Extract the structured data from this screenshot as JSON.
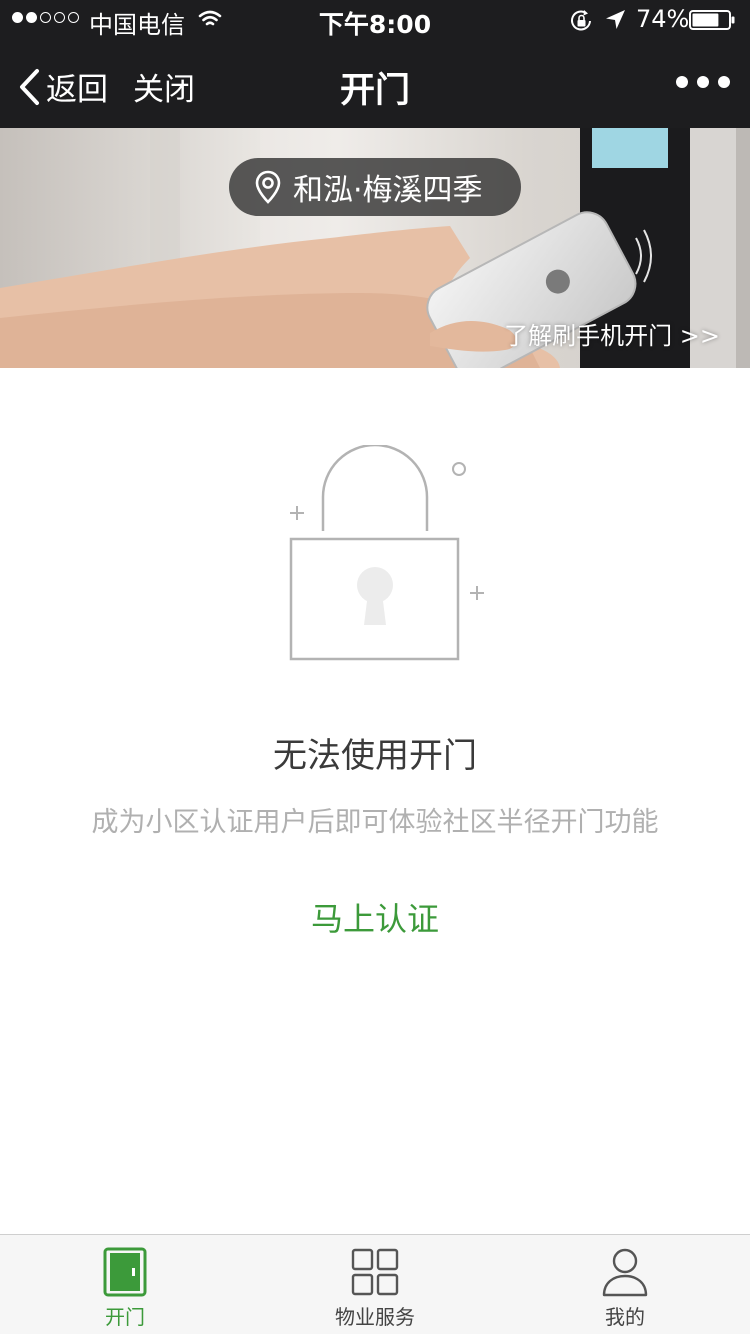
{
  "status_bar": {
    "carrier": "中国电信",
    "time": "下午8:00",
    "battery": "74%",
    "signal_strength": 2,
    "signal_max": 5,
    "battery_level": 0.74
  },
  "nav": {
    "back_label": "返回",
    "close_label": "关闭",
    "title": "开门"
  },
  "banner": {
    "location": "和泓·梅溪四季",
    "learn_link": "了解刷手机开门 >>"
  },
  "main": {
    "title": "无法使用开门",
    "description": "成为小区认证用户后即可体验社区半径开门功能",
    "verify_link": "马上认证"
  },
  "tabs": [
    {
      "label": "开门",
      "icon": "door-icon",
      "active": true
    },
    {
      "label": "物业服务",
      "icon": "grid-icon",
      "active": false
    },
    {
      "label": "我的",
      "icon": "user-icon",
      "active": false
    }
  ],
  "colors": {
    "bar_bg": "#1d1d1f",
    "accent_green": "#3c9a3a",
    "muted_text": "#b0b0b0"
  }
}
